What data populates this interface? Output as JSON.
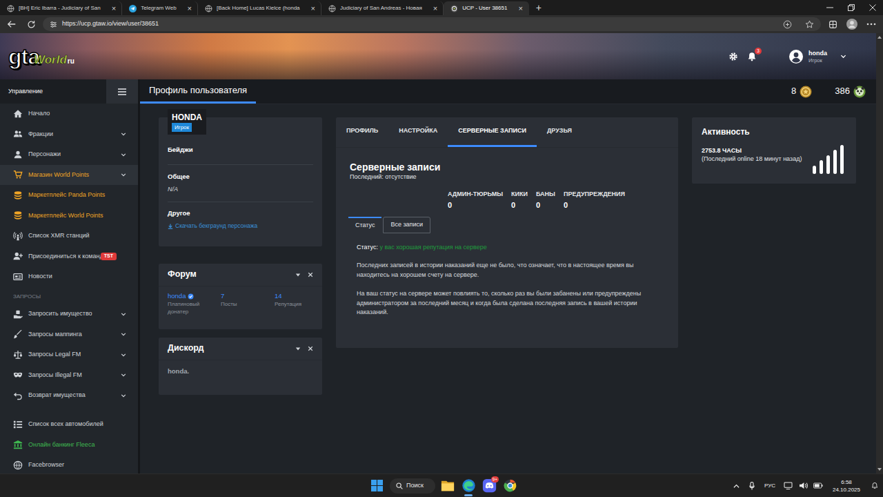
{
  "browser": {
    "tabs": [
      {
        "label": "[BH] Eric Ibarra - Judiciary of San",
        "selected": false
      },
      {
        "label": "Telegram Web",
        "selected": false
      },
      {
        "label": "[Back Home] Lucas Kielce (honda",
        "selected": false
      },
      {
        "label": "Judiciary of San Andreas - Новая",
        "selected": false
      },
      {
        "label": "UCP - User 38651",
        "selected": true
      }
    ],
    "tab_close": "×",
    "new_tab": "+",
    "url": "https://ucp.gtaw.io/view/user/38651"
  },
  "site": {
    "logo": {
      "main": "gta",
      "script": "World",
      "suffix": "ru"
    },
    "notifications": "3",
    "user": {
      "name": "honda",
      "role": "Игрок"
    }
  },
  "sidebar": {
    "title": "Управление",
    "items": [
      {
        "label": "Начало",
        "color": "#cfd3d8",
        "expandable": false,
        "selected": false
      },
      {
        "label": "Фракции",
        "color": "#cfd3d8",
        "expandable": true,
        "selected": false
      },
      {
        "label": "Персонажи",
        "color": "#cfd3d8",
        "expandable": true,
        "selected": false
      },
      {
        "label": "Магазин World Points",
        "color": "#f0a526",
        "expandable": true,
        "selected": true
      },
      {
        "label": "Маркетплейс Panda Points",
        "color": "#f0a526",
        "expandable": false,
        "selected": false
      },
      {
        "label": "Маркетплейс World Points",
        "color": "#f0a526",
        "expandable": false,
        "selected": false
      },
      {
        "label": "Список XMR станций",
        "color": "#cfd3d8",
        "expandable": false,
        "selected": false
      },
      {
        "label": "Присоединиться к команде!",
        "color": "#cfd3d8",
        "expandable": false,
        "selected": false,
        "badge": "TST"
      },
      {
        "label": "Новости",
        "color": "#cfd3d8",
        "expandable": false,
        "selected": false
      }
    ],
    "requests_heading": "ЗАПРОСЫ",
    "requests": [
      {
        "label": "Запросить имущество",
        "color": "#cfd3d8",
        "expandable": true,
        "selected": false
      },
      {
        "label": "Запросы маппинга",
        "color": "#cfd3d8",
        "expandable": true,
        "selected": false
      },
      {
        "label": "Запросы Legal FM",
        "color": "#cfd3d8",
        "expandable": true,
        "selected": false
      },
      {
        "label": "Запросы Illegal FM",
        "color": "#cfd3d8",
        "expandable": true,
        "selected": false
      },
      {
        "label": "Возврат имущества",
        "color": "#cfd3d8",
        "expandable": true,
        "selected": false
      }
    ],
    "bottom_items": [
      {
        "label": "Список всех автомобилей",
        "color": "#cfd3d8",
        "expandable": false,
        "selected": false
      },
      {
        "label": "Онлайн банкинг Fleeca",
        "color": "#3fb950",
        "expandable": false,
        "selected": false
      },
      {
        "label": "Facebrowser",
        "color": "#cfd3d8",
        "expandable": false,
        "selected": false
      }
    ]
  },
  "header": {
    "title": "Профиль пользователя",
    "gold": "8",
    "points": "386"
  },
  "profile": {
    "name": "HONDA",
    "role": "Игрок",
    "badges_label": "Бейджи",
    "general_label": "Общее",
    "general_value": "N/A",
    "other_label": "Другое",
    "download_link": "Скачать бекграунд персонажа"
  },
  "forum": {
    "title": "Форум",
    "user": "honda",
    "rank": "Платиновый донатер",
    "stats": [
      {
        "value": "7",
        "label": "Посты"
      },
      {
        "value": "14",
        "label": "Репутация"
      }
    ]
  },
  "discord": {
    "title": "Дискорд",
    "user": "honda."
  },
  "records": {
    "tabs": [
      {
        "label": "ПРОФИЛЬ",
        "selected": false
      },
      {
        "label": "НАСТРОЙКА",
        "selected": false
      },
      {
        "label": "СЕРВЕРНЫЕ ЗАПИСИ",
        "selected": true
      },
      {
        "label": "ДРУЗЬЯ",
        "selected": false
      }
    ],
    "title": "Серверные записи",
    "last": "Последний: отсутствие",
    "stats": [
      {
        "label": "АДМИН-ТЮРЬМЫ",
        "value": "0"
      },
      {
        "label": "КИКИ",
        "value": "0"
      },
      {
        "label": "БАНЫ",
        "value": "0"
      },
      {
        "label": "ПРЕДУПРЕЖДЕНИЯ",
        "value": "0"
      }
    ],
    "subtabs": [
      {
        "label": "Статус",
        "selected": true
      },
      {
        "label": "Все записи",
        "selected": false
      }
    ],
    "status_label": "Статус:",
    "status_text": "у вас хорошая репутация на сервере",
    "paragraphs": [
      "Последних записей в истории наказаний еще не было, что означает, что в настоящее время вы находитесь на хорошем счету на сервере.",
      "На ваш статус на сервере может повлиять то, сколько раз вы были забанены или предупреждены администратором за последний месяц и когда была сделана последняя запись в вашей истории наказаний."
    ]
  },
  "activity": {
    "title": "Активность",
    "hours": "2753.8 ЧАСЫ",
    "last_online": "(Последний online 18 минут назад)"
  },
  "taskbar": {
    "search": "Поиск",
    "apps": [
      {
        "active": false
      },
      {
        "active": true
      },
      {
        "active": false,
        "badge": "9+"
      },
      {
        "active": false
      }
    ],
    "language": "РУС",
    "time": "6:58",
    "date": "24.10.2025"
  }
}
